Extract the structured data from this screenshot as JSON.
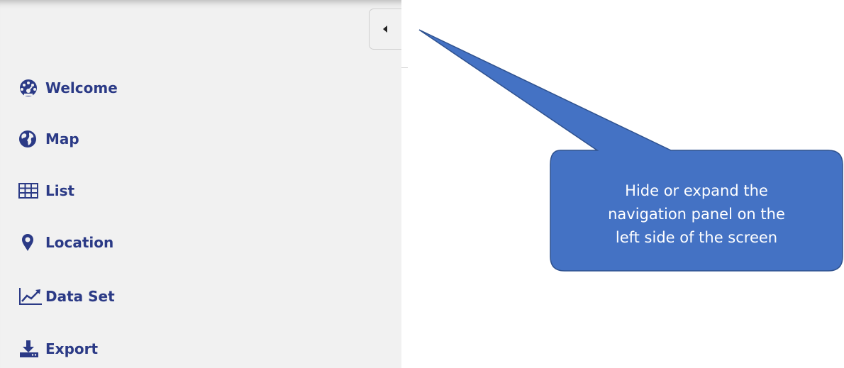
{
  "sidebar": {
    "toggle_icon": "caret-left-icon",
    "items": [
      {
        "label": "Welcome",
        "icon": "dashboard-icon"
      },
      {
        "label": "Map",
        "icon": "globe-icon"
      },
      {
        "label": "List",
        "icon": "table-icon"
      },
      {
        "label": "Location",
        "icon": "map-marker-icon"
      },
      {
        "label": "Data Set",
        "icon": "line-chart-icon"
      },
      {
        "label": "Export",
        "icon": "download-icon"
      }
    ]
  },
  "callout": {
    "line1": "Hide or expand the",
    "line2": "navigation panel on the",
    "line3": "left side of the screen",
    "fill": "#4472c4",
    "stroke": "#2f528f"
  },
  "colors": {
    "nav_text": "#2b3a86",
    "sidebar_bg": "#f1f1f1"
  }
}
